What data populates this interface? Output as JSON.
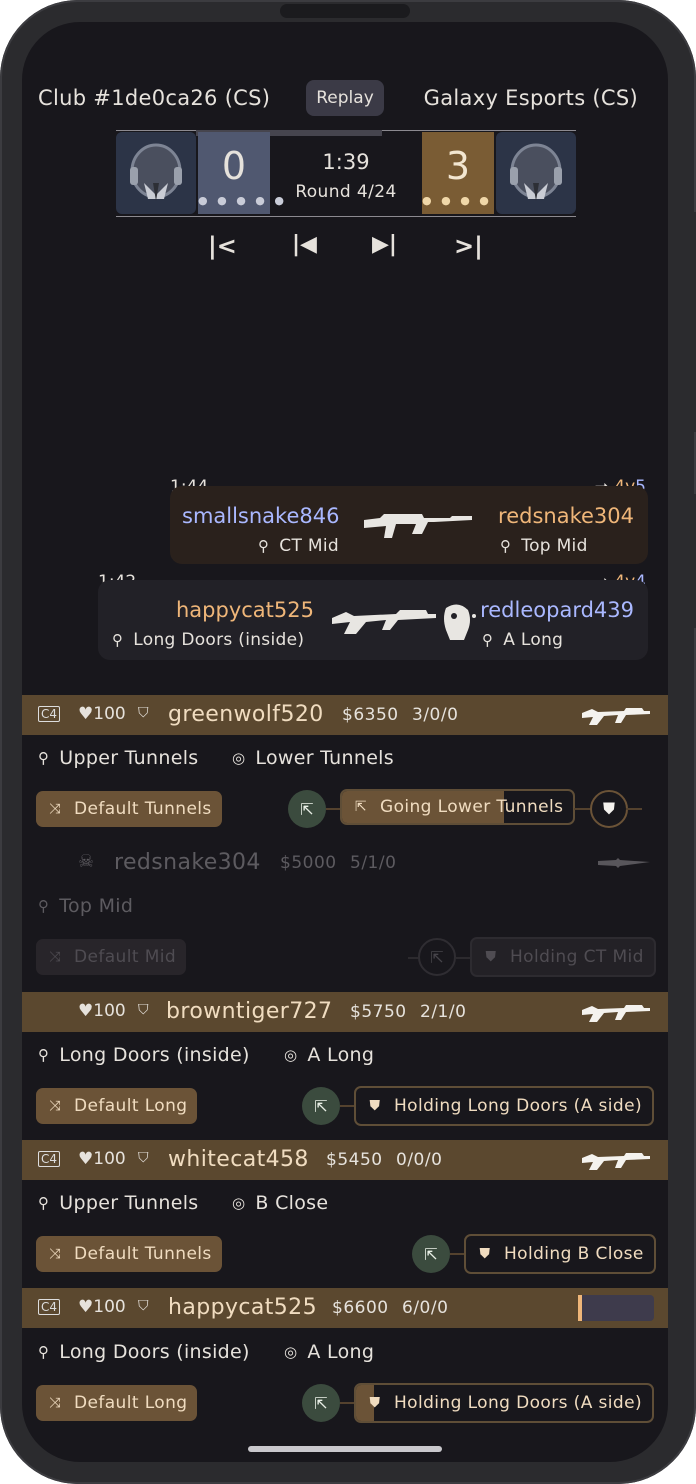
{
  "header": {
    "left_team": "Club #1de0ca26 (CS)",
    "replay_button": "Replay",
    "right_team": "Galaxy Esports (CS)"
  },
  "scoreboard": {
    "left_score": "0",
    "right_score": "3",
    "clock": "1:39",
    "round": "Round 4/24",
    "round_progress": 0.62
  },
  "playback": {
    "first_icon": "skip-to-start-icon",
    "prev_icon": "previous-icon",
    "next_icon": "next-icon",
    "last_icon": "skip-to-end-icon"
  },
  "kill_feed": [
    {
      "time": "1:44",
      "alive": "4v5",
      "alive_left": "4v",
      "alive_right": "5",
      "killer": "smallsnake846",
      "killer_location": "CT Mid",
      "victim": "redsnake304",
      "victim_location": "Top Mid",
      "weapon_icon": "rifle-icon"
    },
    {
      "time": "1:42",
      "alive": "4v4",
      "alive_left": "4v",
      "alive_right": "4",
      "killer": "happycat525",
      "killer_location": "Long Doors (inside)",
      "victim": "redleopard439",
      "victim_location": "A Long",
      "weapon_icon": "rifle-icon",
      "headshot_icon": "headshot-icon"
    }
  ],
  "players": [
    {
      "name": "greenwolf520",
      "health": "100",
      "money": "$6350",
      "kda": "3/0/0",
      "has_bomb": true,
      "current_location": "Upper Tunnels",
      "target_location": "Lower Tunnels",
      "strategy": "Default Tunnels",
      "action": "Going Lower Tunnels",
      "action_progress": 0.7,
      "weapon_icon": "rifle-icon"
    },
    {
      "name": "redsnake304",
      "dead": true,
      "money": "$5000",
      "kda": "5/1/0",
      "current_location": "Top Mid",
      "strategy": "Default Mid",
      "action": "Holding CT Mid",
      "weapon_icon": "knife-icon"
    },
    {
      "name": "browntiger727",
      "health": "100",
      "money": "$5750",
      "kda": "2/1/0",
      "current_location": "Long Doors (inside)",
      "target_location": "A Long",
      "strategy": "Default Long",
      "action": "Holding Long Doors (A side)",
      "weapon_icon": "rifle-icon"
    },
    {
      "name": "whitecat458",
      "health": "100",
      "money": "$5450",
      "kda": "0/0/0",
      "has_bomb": true,
      "current_location": "Upper Tunnels",
      "target_location": "B Close",
      "strategy": "Default Tunnels",
      "action": "Holding B Close",
      "weapon_icon": "rifle-icon"
    },
    {
      "name": "happycat525",
      "health": "100",
      "money": "$6600",
      "kda": "6/0/0",
      "has_bomb": true,
      "current_location": "Long Doors (inside)",
      "target_location": "A Long",
      "strategy": "Default Long",
      "action": "Holding Long Doors (A side)",
      "action_progress": 0.06
    }
  ],
  "colors": {
    "background": "#18171c",
    "team_t": "#efb679",
    "team_ct": "#aab8ff",
    "band": "#5b482f",
    "pill": "#6b5337"
  }
}
